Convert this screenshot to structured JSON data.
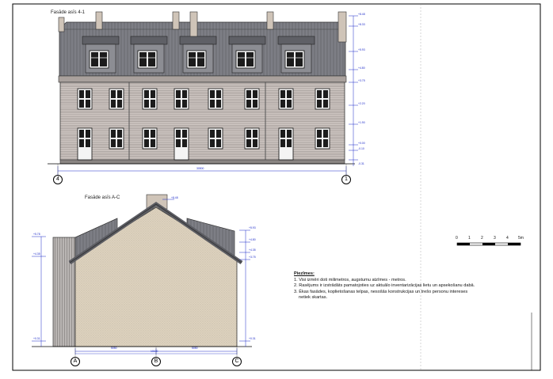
{
  "facade_top": {
    "title": "Fasāde asīs 4-1",
    "axis_left": "4",
    "axis_right": "1",
    "overall_dim": "30500",
    "elevations": [
      "+8.48",
      "+8.33",
      "+5.93",
      "+4.80",
      "+3.75",
      "+2.20",
      "+1.90",
      "+0.00",
      "-0.10",
      "-0.31"
    ]
  },
  "facade_side": {
    "title": "Fasāde asīs A-C",
    "axes": [
      "A",
      "B",
      "C"
    ],
    "overall_dim": "10100",
    "part_dims": [
      "5050",
      "5050"
    ],
    "top_dim": "+8.48",
    "elevations_left": [
      "+5.78",
      "+4.35",
      "+0.31"
    ],
    "elevations_right": [
      "+5.93",
      "+4.80",
      "+4.35",
      "+3.75",
      "+0.31"
    ]
  },
  "scale_bar": {
    "labels": [
      "0",
      "1",
      "2",
      "3",
      "4",
      "5m"
    ]
  },
  "notes": {
    "heading": "Piezīmes:",
    "items": [
      "1. Visi izmēri doti milimetros, augstumu atzīmes - metros.",
      "2. Rasējums ir izstrādāts pamatojoties uz aktuālo inventarizācijas lietu un apsekošanu dabā.",
      "3. Ēkas fasādes, koplietošanas telpas, nesošās konstrukcijas un trešo personu intereses",
      "netiek skartas."
    ]
  }
}
